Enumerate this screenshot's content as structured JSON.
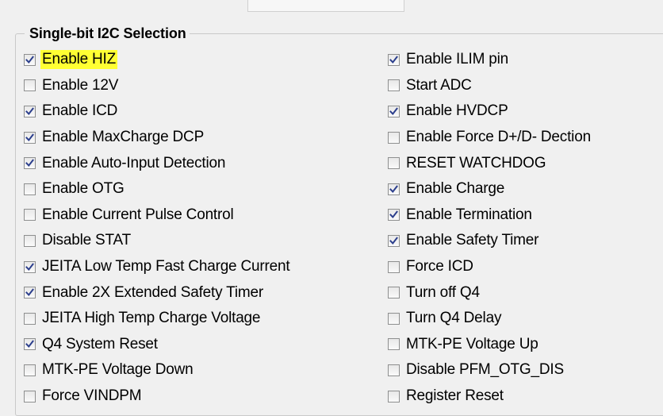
{
  "group": {
    "title": "Single-bit I2C Selection"
  },
  "left_options": [
    {
      "label": "Enable HIZ",
      "checked": true,
      "highlight": true
    },
    {
      "label": "Enable 12V",
      "checked": false
    },
    {
      "label": "Enable ICD",
      "checked": true
    },
    {
      "label": "Enable MaxCharge DCP",
      "checked": true
    },
    {
      "label": "Enable Auto-Input Detection",
      "checked": true
    },
    {
      "label": "Enable OTG",
      "checked": false
    },
    {
      "label": "Enable Current Pulse Control",
      "checked": false
    },
    {
      "label": "Disable STAT",
      "checked": false
    },
    {
      "label": "JEITA Low Temp Fast Charge Current",
      "checked": true
    },
    {
      "label": "Enable 2X Extended Safety Timer",
      "checked": true
    },
    {
      "label": "JEITA High Temp Charge Voltage",
      "checked": false
    },
    {
      "label": "Q4 System Reset",
      "checked": true
    },
    {
      "label": "MTK-PE Voltage Down",
      "checked": false
    },
    {
      "label": "Force VINDPM",
      "checked": false
    }
  ],
  "right_options": [
    {
      "label": "Enable ILIM pin",
      "checked": true
    },
    {
      "label": "Start ADC",
      "checked": false
    },
    {
      "label": "Enable HVDCP",
      "checked": true
    },
    {
      "label": "Enable Force D+/D- Dection",
      "checked": false
    },
    {
      "label": "RESET WATCHDOG",
      "checked": false
    },
    {
      "label": "Enable Charge",
      "checked": true
    },
    {
      "label": "Enable Termination",
      "checked": true
    },
    {
      "label": "Enable Safety Timer",
      "checked": true
    },
    {
      "label": "Force ICD",
      "checked": false
    },
    {
      "label": "Turn off Q4",
      "checked": false
    },
    {
      "label": "Turn Q4 Delay",
      "checked": false
    },
    {
      "label": "MTK-PE Voltage Up",
      "checked": false
    },
    {
      "label": "Disable PFM_OTG_DIS",
      "checked": false
    },
    {
      "label": "Register Reset",
      "checked": false
    }
  ],
  "colors": {
    "highlight": "#ffff33",
    "check_mark": "#2b3e8c"
  }
}
